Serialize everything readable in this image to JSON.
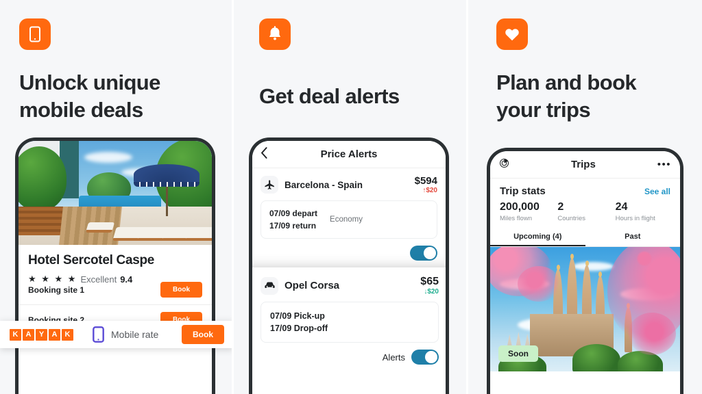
{
  "panels": [
    {
      "id": "mobile-deals",
      "icon": "mobile-phone-icon",
      "headline_line1": "Unlock unique",
      "headline_line2": "mobile deals",
      "hotel": {
        "name": "Hotel Sercotel Caspe",
        "stars": "★ ★ ★ ★",
        "rating_word": "Excellent",
        "rating_score": "9.4"
      },
      "mobile_bar": {
        "logo_letters": [
          "K",
          "A",
          "Y",
          "A",
          "K"
        ],
        "label": "Mobile rate",
        "book_label": "Book",
        "phone_icon": "mobile-phone-icon"
      },
      "booking_sites": [
        {
          "name": "Booking site 1",
          "book_label": "Book"
        },
        {
          "name": "Booking site 2",
          "book_label": "Book"
        }
      ]
    },
    {
      "id": "deal-alerts",
      "icon": "bell-icon",
      "headline_line1": "Get deal alerts",
      "headline_line2": "",
      "app_header": {
        "title": "Price Alerts",
        "back_icon": "chevron-left-icon"
      },
      "flight_alert": {
        "icon": "airplane-icon",
        "name": "Barcelona - Spain",
        "price": "$594",
        "delta": "↑$20",
        "delta_direction": "up",
        "date_depart": "07/09 depart",
        "date_return": "17/09 return",
        "cabin": "Economy"
      },
      "car_alert": {
        "icon": "car-icon",
        "name": "Opel Corsa",
        "price": "$65",
        "delta": "↓$20",
        "delta_direction": "down",
        "date_pickup": "07/09 Pick-up",
        "date_dropoff": "17/09 Drop-off",
        "alerts_label": "Alerts",
        "alerts_on": true
      }
    },
    {
      "id": "plan-book-trips",
      "icon": "heart-icon",
      "headline_line1": "Plan and book",
      "headline_line2": "your trips",
      "app_header": {
        "title": "Trips",
        "left_icon": "target-chart-icon",
        "right_icon": "more-options-icon"
      },
      "trip_stats": {
        "title": "Trip stats",
        "see_all": "See all",
        "stats": [
          {
            "value": "200,000",
            "label": "Miles flown"
          },
          {
            "value": "2",
            "label": "Countries"
          },
          {
            "value": "24",
            "label": "Hours in flight"
          }
        ]
      },
      "tabs": [
        {
          "label": "Upcoming (4)",
          "active": true
        },
        {
          "label": "Past",
          "active": false
        }
      ],
      "trip_card": {
        "badge": "Soon",
        "image": "sagrada-familia-barcelona"
      }
    }
  ],
  "colors": {
    "brand_orange": "#ff690f",
    "headline": "#25282b",
    "panel_bg": "#f6f7f9",
    "toggle_on": "#1f7fa8",
    "price_up": "#e4483c",
    "price_down": "#1fae8f",
    "see_all_link": "#2196c7",
    "soon_badge": "#c9f0c8"
  }
}
